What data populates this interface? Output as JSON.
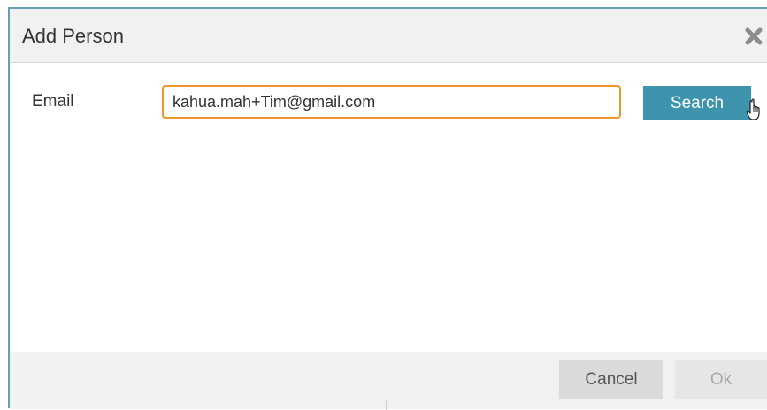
{
  "dialog": {
    "title": "Add Person",
    "close_icon": "close-icon"
  },
  "form": {
    "email_label": "Email",
    "email_value": "kahua.mah+Tim@gmail.com",
    "search_label": "Search"
  },
  "footer": {
    "cancel_label": "Cancel",
    "ok_label": "Ok"
  },
  "colors": {
    "accent": "#3f94ad",
    "input_focus_border": "#f0952b",
    "dialog_border": "#6a9cb3"
  }
}
